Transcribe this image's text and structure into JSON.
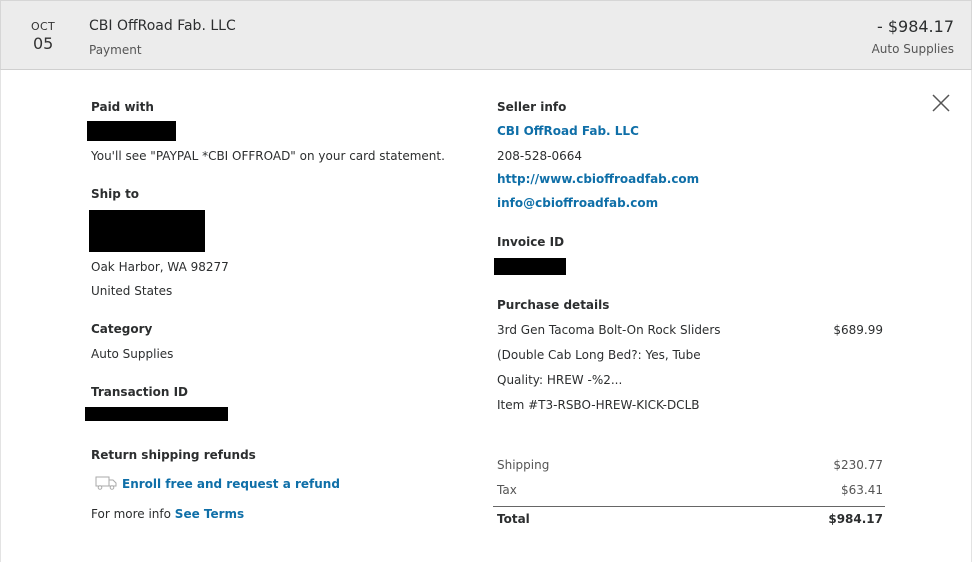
{
  "header": {
    "month": "OCT",
    "day": "05",
    "merchant": "CBI OffRoad Fab. LLC",
    "payment_type": "Payment",
    "amount": "- $984.17",
    "category": "Auto Supplies"
  },
  "left": {
    "paid_with_heading": "Paid with",
    "statement_note": "You'll see \"PAYPAL *CBI OFFROAD\" on your card statement.",
    "ship_to_heading": "Ship to",
    "ship_city": "Oak Harbor, WA 98277",
    "ship_country": "United States",
    "category_heading": "Category",
    "category_value": "Auto Supplies",
    "transaction_heading": "Transaction ID",
    "return_heading": "Return shipping refunds",
    "enroll_link": "Enroll free and request a refund",
    "more_info_text": "For more info",
    "see_terms_link": "See Terms"
  },
  "right": {
    "seller_heading": "Seller info",
    "seller_name": "CBI OffRoad Fab. LLC",
    "seller_phone": "208-528-0664",
    "seller_website": "http://www.cbioffroadfab.com",
    "seller_email": "info@cbioffroadfab.com",
    "invoice_heading": "Invoice ID",
    "purchase_heading": "Purchase details",
    "item_line1": "3rd Gen Tacoma Bolt-On Rock Sliders",
    "item_price": "$689.99",
    "item_line2": "(Double Cab Long Bed?: Yes, Tube",
    "item_line3": "Quality: HREW -%2...",
    "item_number": "Item #T3-RSBO-HREW-KICK-DCLB",
    "shipping_label": "Shipping",
    "shipping_value": "$230.77",
    "tax_label": "Tax",
    "tax_value": "$63.41",
    "total_label": "Total",
    "total_value": "$984.17"
  },
  "icons": {
    "close": "close-icon",
    "truck": "truck-icon"
  },
  "colors": {
    "link": "#0f6fa8",
    "header_bg": "#ececec"
  }
}
